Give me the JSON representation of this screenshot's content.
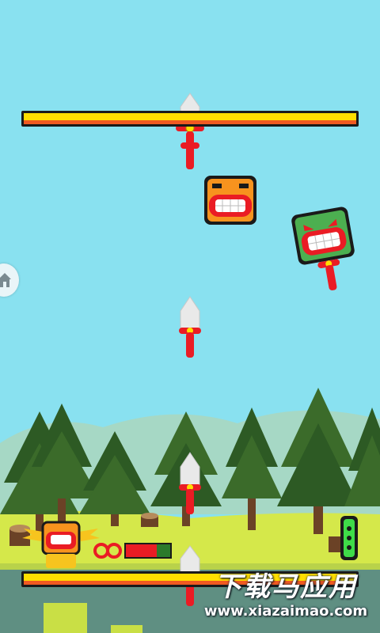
{
  "game": {
    "top_timer_bar": {
      "fill_color": "#ffde00",
      "accent_color": "#f05a22",
      "fill_fraction": 1.0
    },
    "bottom_timer_bar": {
      "fill_color": "#ffde00",
      "accent_color": "#f05a22",
      "fill_fraction": 1.0
    },
    "player": {
      "health_fraction": 0.7,
      "health_color": "#ea1c24",
      "lives_icon": "infinity-icon"
    },
    "enemies": [
      {
        "name": "orange-block-monster",
        "color": "#f7931e"
      },
      {
        "name": "green-block-monster",
        "color": "#4caf50"
      }
    ],
    "home_button_icon": "home-icon",
    "sky_color": "#89e1f0",
    "grass_color": "#d5e84a"
  },
  "watermark": {
    "cn": "下载马应用",
    "en": "www.xiazaimao.com"
  }
}
